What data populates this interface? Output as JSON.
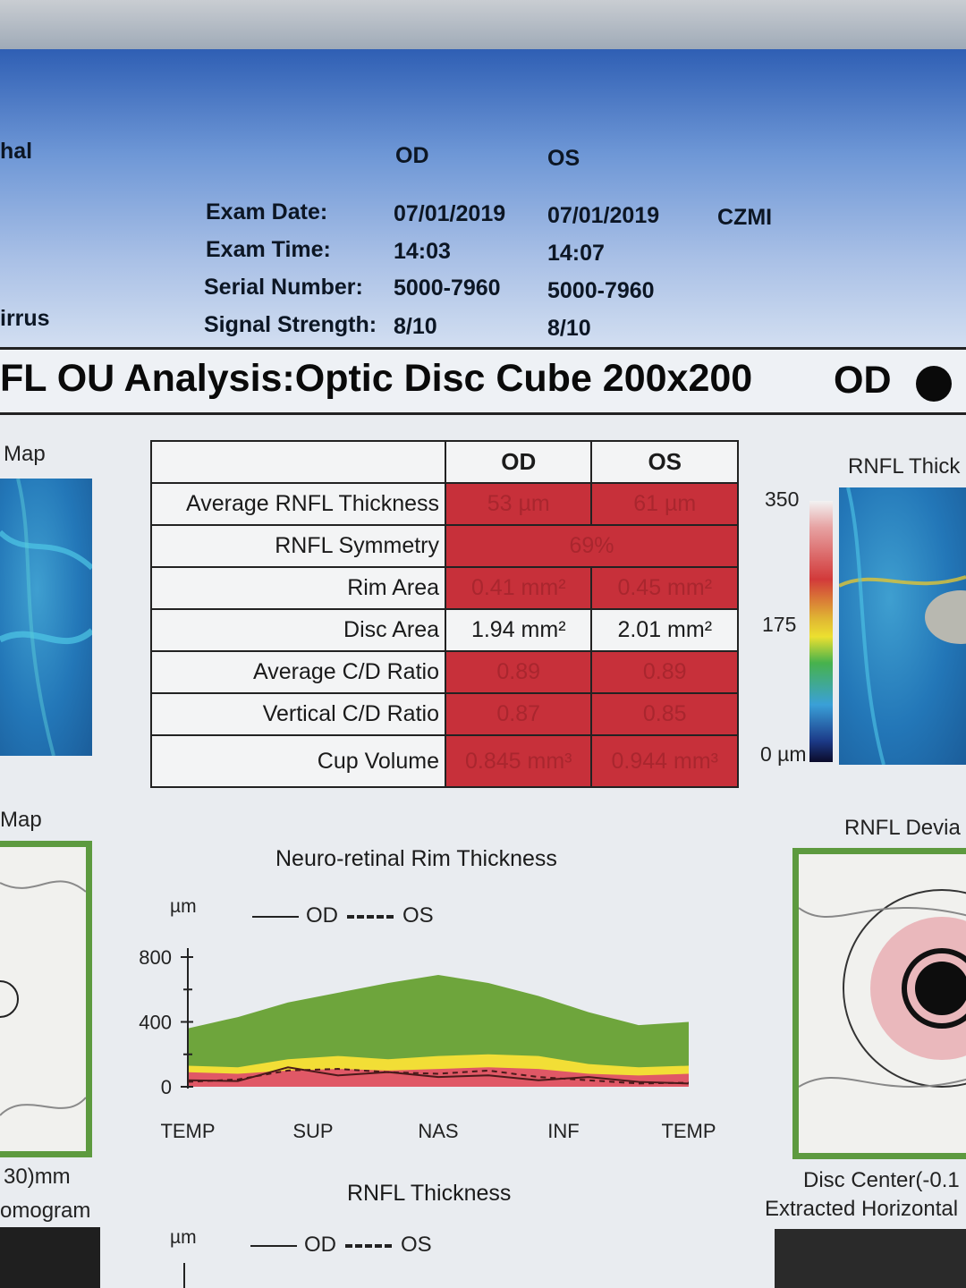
{
  "header": {
    "left_title_fragment": "hal",
    "left_device_fragment": "irrus",
    "col_od": "OD",
    "col_os": "OS",
    "rows": [
      {
        "label": "Exam Date:",
        "od": "07/01/2019",
        "os": "07/01/2019"
      },
      {
        "label": "Exam Time:",
        "od": "14:03",
        "os": "14:07"
      },
      {
        "label": "Serial Number:",
        "od": "5000-7960",
        "os": "5000-7960"
      },
      {
        "label": "Signal Strength:",
        "od": "8/10",
        "os": "8/10"
      }
    ],
    "operator": "CZMI"
  },
  "title_bar": {
    "title": "FL OU Analysis:Optic Disc Cube 200x200",
    "eye": "OD"
  },
  "left_panel": {
    "top_label": "Map",
    "mid_label": "Map",
    "foot1": "30)mm",
    "foot2": "omogram"
  },
  "right_panel": {
    "top_label": "RNFL Thick",
    "mid_label": "RNFL Devia",
    "foot1": "Disc Center(-0.1",
    "foot2": "Extracted Horizontal",
    "scale_top": "350",
    "scale_mid": "175",
    "scale_bottom": "0 µm"
  },
  "metrics_table": {
    "col_od": "OD",
    "col_os": "OS",
    "rows": [
      {
        "label": "Average RNFL Thickness",
        "od": "53 µm",
        "os": "61 µm"
      },
      {
        "label": "RNFL Symmetry",
        "merged": "69%"
      },
      {
        "label": "Rim Area",
        "od": "0.41 mm²",
        "os": "0.45 mm²"
      },
      {
        "label": "Disc Area",
        "od": "1.94 mm²",
        "os": "2.01 mm²"
      },
      {
        "label": "Average C/D Ratio",
        "od": "0.89",
        "os": "0.89"
      },
      {
        "label": "Vertical C/D Ratio",
        "od": "0.87",
        "os": "0.85"
      },
      {
        "label": "Cup Volume",
        "od": "0.845 mm³",
        "os": "0.944 mm³"
      }
    ]
  },
  "rim_chart_labels": {
    "title": "Neuro-retinal Rim Thickness",
    "unit": "µm",
    "legend_od": "OD",
    "legend_os": "OS"
  },
  "chart_data": {
    "type": "line",
    "title": "Neuro-retinal Rim Thickness",
    "ylabel": "µm",
    "ylim": [
      0,
      800
    ],
    "yticks": [
      "0",
      "400",
      "800"
    ],
    "x_ticks": [
      "TEMP",
      "SUP",
      "NAS",
      "INF",
      "TEMP"
    ],
    "x": [
      0,
      10,
      20,
      30,
      40,
      50,
      60,
      70,
      80,
      90,
      100
    ],
    "normative": {
      "top_values": [
        360,
        430,
        520,
        580,
        640,
        690,
        640,
        560,
        460,
        380,
        400
      ],
      "yellow_upper": [
        130,
        120,
        170,
        190,
        170,
        190,
        200,
        190,
        140,
        120,
        130
      ],
      "red_upper": [
        90,
        80,
        100,
        110,
        100,
        110,
        120,
        110,
        80,
        70,
        80
      ],
      "colors": {
        "green": "#6ea53c",
        "yellow": "#f2de36",
        "red": "#e05866"
      }
    },
    "series": [
      {
        "name": "OD",
        "style": "solid",
        "values": [
          40,
          35,
          120,
          70,
          90,
          60,
          70,
          40,
          60,
          30,
          20
        ]
      },
      {
        "name": "OS",
        "style": "dashed",
        "values": [
          30,
          45,
          100,
          110,
          90,
          80,
          100,
          60,
          40,
          20,
          25
        ]
      }
    ]
  },
  "rnfl_chart_labels": {
    "title": "RNFL Thickness",
    "unit": "µm",
    "legend_od": "OD",
    "legend_os": "OS"
  }
}
